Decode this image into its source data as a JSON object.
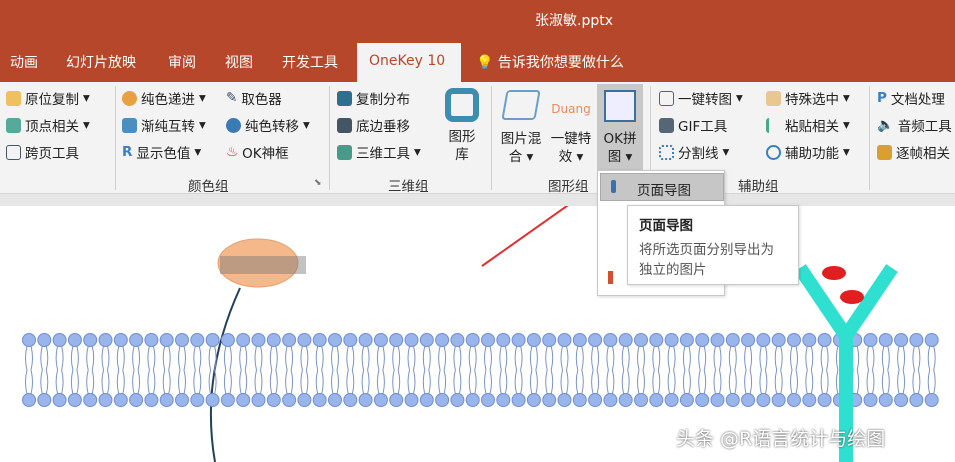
{
  "title": "张淑敏.pptx",
  "tabs": [
    "动画",
    "幻灯片放映",
    "审阅",
    "视图",
    "开发工具",
    "OneKey 10",
    "告诉我你想要做什么"
  ],
  "ribbon": {
    "col1": [
      "原位复制",
      "顶点相关",
      "跨页工具"
    ],
    "col2": [
      "纯色递进",
      "渐纯互转",
      "显示色值"
    ],
    "col3": [
      "取色器",
      "纯色转移",
      "OK神框"
    ],
    "col4": [
      "复制分布",
      "底边垂移",
      "三维工具"
    ],
    "big_gallery": "图形库",
    "big_blend": [
      "图片混",
      "合"
    ],
    "big_effect": [
      "一键特",
      "效"
    ],
    "duang": "Duang",
    "big_puzzle": [
      "OK拼",
      "图"
    ],
    "col5": [
      "一键转图",
      "GIF工具",
      "分割线"
    ],
    "col6": [
      "特殊选中",
      "粘贴相关",
      "辅助功能"
    ],
    "col7": [
      "文档处理",
      "音频工具",
      "逐帧相关"
    ],
    "groups": [
      "颜色组",
      "三维组",
      "图形组",
      "辅助组"
    ]
  },
  "menu": {
    "item": "页面导图"
  },
  "tooltip": {
    "title": "页面导图",
    "desc1": "将所选页面分别导出为",
    "desc2": "独立的图片"
  },
  "watermark": "头条 @R语言统计与绘图"
}
